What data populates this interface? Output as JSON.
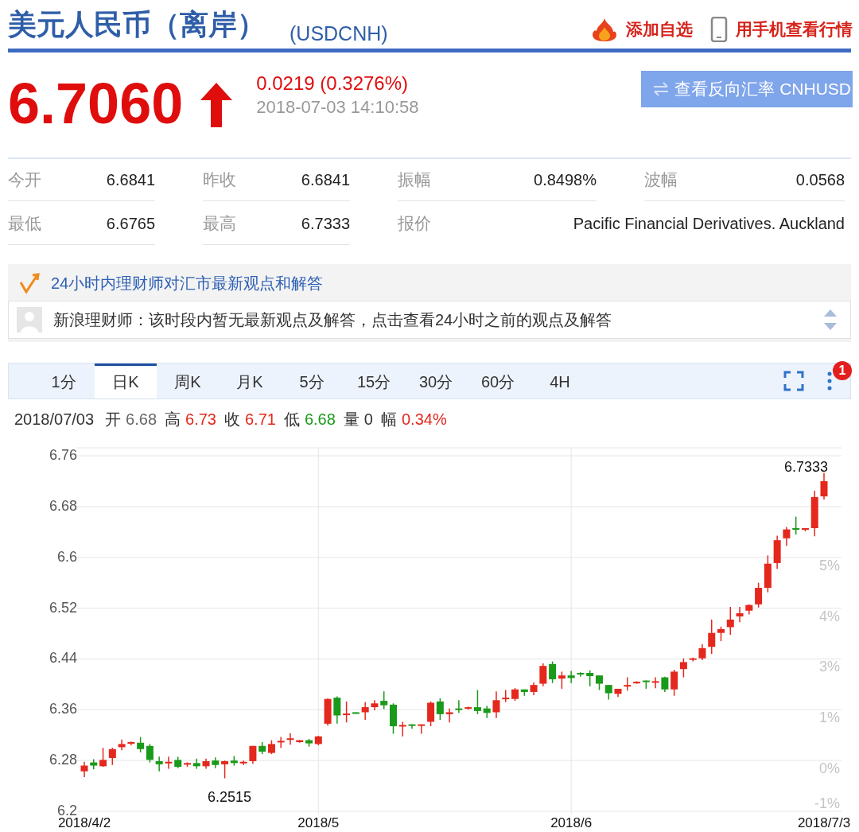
{
  "header": {
    "title": "美元人民币（离岸）",
    "symbol": "(USDCNH)",
    "actions": [
      {
        "kind": "favorite",
        "label": "添加自选"
      },
      {
        "kind": "mobile",
        "label": "用手机查看行情"
      }
    ]
  },
  "quote": {
    "price": "6.7060",
    "rising": true,
    "change": "0.0219 (0.3276%)",
    "time": "2018-07-03 14:10:58",
    "reverse_button": "查看反向汇率 CNHUSD"
  },
  "stats": [
    {
      "label": "今开",
      "value": "6.6841",
      "wide": false
    },
    {
      "label": "昨收",
      "value": "6.6841",
      "wide": false
    },
    {
      "label": "振幅",
      "value": "0.8498%",
      "wide": false
    },
    {
      "label": "波幅",
      "value": "0.0568",
      "wide": false
    },
    {
      "label": "最低",
      "value": "6.6765",
      "wide": false
    },
    {
      "label": "最高",
      "value": "6.7333",
      "wide": false
    },
    {
      "label": "报价",
      "value": "Pacific Financial Derivatives. Auckland",
      "wide": true
    }
  ],
  "advisor": {
    "heading": "24小时内理财师对汇市最新观点和解答",
    "message": "新浪理财师：该时段内暂无最新观点及解答，点击查看24小时之前的观点及解答"
  },
  "chart_tabs": [
    {
      "label": "1分",
      "selected": false
    },
    {
      "label": "日K",
      "selected": true
    },
    {
      "label": "周K",
      "selected": false
    },
    {
      "label": "月K",
      "selected": false
    },
    {
      "label": "5分",
      "selected": false
    },
    {
      "label": "15分",
      "selected": false
    },
    {
      "label": "30分",
      "selected": false
    },
    {
      "label": "60分",
      "selected": false
    },
    {
      "label": "4H",
      "selected": false
    }
  ],
  "menu_badge": "1",
  "ohlc_line": {
    "date": "2018/07/03",
    "items": [
      {
        "label": "开",
        "value": "6.68",
        "color": "#666666"
      },
      {
        "label": "高",
        "value": "6.73",
        "color": "#e4281d"
      },
      {
        "label": "收",
        "value": "6.71",
        "color": "#e4281d"
      },
      {
        "label": "低",
        "value": "6.68",
        "color": "#1a9a1a"
      },
      {
        "label": "量",
        "value": "0",
        "color": "#333333"
      },
      {
        "label": "幅",
        "value": "0.34%",
        "color": "#e4281d"
      }
    ]
  },
  "chart": {
    "right_axis_labels": [
      "5%",
      "4%",
      "3%",
      "1%",
      "0%",
      "-1%"
    ],
    "chart_data": {
      "type": "candlestick",
      "grid": true,
      "ylim": [
        6.2,
        6.76
      ],
      "yticks": [
        6.2,
        6.28,
        6.36,
        6.44,
        6.52,
        6.6,
        6.68,
        6.76
      ],
      "annotations": [
        {
          "text": "6.2515"
        },
        {
          "text": "6.7333"
        }
      ],
      "categories": [
        "2018/4/2",
        null,
        null,
        null,
        null,
        null,
        null,
        null,
        null,
        null,
        null,
        null,
        null,
        null,
        null,
        null,
        null,
        null,
        null,
        null,
        null,
        null,
        null,
        null,
        null,
        "2018/5",
        null,
        null,
        null,
        null,
        null,
        null,
        null,
        null,
        null,
        null,
        null,
        null,
        null,
        null,
        null,
        null,
        null,
        null,
        null,
        null,
        null,
        null,
        null,
        null,
        null,
        null,
        "2018/6",
        null,
        null,
        null,
        null,
        null,
        null,
        null,
        null,
        null,
        null,
        null,
        null,
        null,
        null,
        null,
        null,
        null,
        null,
        null,
        null,
        null,
        null,
        null,
        null,
        null,
        null,
        "2018/7/3"
      ],
      "ohlc": [
        [
          6.263,
          6.278,
          6.254,
          6.272
        ],
        [
          6.277,
          6.282,
          6.266,
          6.272
        ],
        [
          6.271,
          6.3,
          6.27,
          6.281
        ],
        [
          6.284,
          6.3,
          6.273,
          6.298
        ],
        [
          6.301,
          6.313,
          6.296,
          6.306
        ],
        [
          6.307,
          6.31,
          6.304,
          6.309
        ],
        [
          6.308,
          6.317,
          6.293,
          6.298
        ],
        [
          6.303,
          6.306,
          6.277,
          6.281
        ],
        [
          6.279,
          6.286,
          6.263,
          6.274
        ],
        [
          6.277,
          6.286,
          6.267,
          6.278
        ],
        [
          6.281,
          6.286,
          6.268,
          6.27
        ],
        [
          6.275,
          6.277,
          6.27,
          6.276
        ],
        [
          6.276,
          6.283,
          6.267,
          6.271
        ],
        [
          6.271,
          6.283,
          6.267,
          6.279
        ],
        [
          6.28,
          6.285,
          6.268,
          6.273
        ],
        [
          6.274,
          6.28,
          6.252,
          6.279
        ],
        [
          6.28,
          6.287,
          6.272,
          6.276
        ],
        [
          6.277,
          6.28,
          6.273,
          6.278
        ],
        [
          6.279,
          6.303,
          6.275,
          6.303
        ],
        [
          6.303,
          6.309,
          6.29,
          6.294
        ],
        [
          6.292,
          6.312,
          6.29,
          6.306
        ],
        [
          6.309,
          6.317,
          6.3,
          6.311
        ],
        [
          6.314,
          6.323,
          6.305,
          6.315
        ],
        [
          6.309,
          6.312,
          6.308,
          6.312
        ],
        [
          6.312,
          6.314,
          6.302,
          6.307
        ],
        [
          6.306,
          6.319,
          6.304,
          6.318
        ],
        [
          6.338,
          6.378,
          6.335,
          6.377
        ],
        [
          6.379,
          6.381,
          6.338,
          6.351
        ],
        [
          6.352,
          6.373,
          6.34,
          6.354
        ],
        [
          6.356,
          6.356,
          6.354,
          6.355
        ],
        [
          6.356,
          6.372,
          6.344,
          6.364
        ],
        [
          6.364,
          6.375,
          6.359,
          6.37
        ],
        [
          6.374,
          6.389,
          6.361,
          6.367
        ],
        [
          6.368,
          6.37,
          6.322,
          6.334
        ],
        [
          6.334,
          6.341,
          6.318,
          6.336
        ],
        [
          6.337,
          6.337,
          6.33,
          6.335
        ],
        [
          6.336,
          6.337,
          6.322,
          6.337
        ],
        [
          6.341,
          6.373,
          6.334,
          6.371
        ],
        [
          6.373,
          6.378,
          6.344,
          6.353
        ],
        [
          6.353,
          6.362,
          6.34,
          6.356
        ],
        [
          6.362,
          6.375,
          6.355,
          6.361
        ],
        [
          6.362,
          6.365,
          6.36,
          6.364
        ],
        [
          6.364,
          6.391,
          6.353,
          6.358
        ],
        [
          6.362,
          6.366,
          6.347,
          6.355
        ],
        [
          6.356,
          6.389,
          6.347,
          6.375
        ],
        [
          6.378,
          6.391,
          6.372,
          6.379
        ],
        [
          6.377,
          6.394,
          6.374,
          6.392
        ],
        [
          6.392,
          6.392,
          6.382,
          6.388
        ],
        [
          6.388,
          6.403,
          6.383,
          6.399
        ],
        [
          6.401,
          6.433,
          6.397,
          6.429
        ],
        [
          6.432,
          6.436,
          6.402,
          6.408
        ],
        [
          6.409,
          6.42,
          6.393,
          6.414
        ],
        [
          6.414,
          6.421,
          6.402,
          6.41
        ],
        [
          6.418,
          6.419,
          6.412,
          6.416
        ],
        [
          6.418,
          6.422,
          6.397,
          6.413
        ],
        [
          6.414,
          6.414,
          6.391,
          6.401
        ],
        [
          6.399,
          6.399,
          6.376,
          6.386
        ],
        [
          6.385,
          6.393,
          6.38,
          6.393
        ],
        [
          6.398,
          6.411,
          6.39,
          6.399
        ],
        [
          6.403,
          6.405,
          6.401,
          6.404
        ],
        [
          6.406,
          6.406,
          6.393,
          6.405
        ],
        [
          6.404,
          6.411,
          6.394,
          6.405
        ],
        [
          6.411,
          6.412,
          6.388,
          6.392
        ],
        [
          6.392,
          6.423,
          6.382,
          6.42
        ],
        [
          6.424,
          6.441,
          6.411,
          6.435
        ],
        [
          6.44,
          6.442,
          6.436,
          6.441
        ],
        [
          6.441,
          6.463,
          6.438,
          6.457
        ],
        [
          6.459,
          6.502,
          6.448,
          6.481
        ],
        [
          6.481,
          6.491,
          6.468,
          6.487
        ],
        [
          6.49,
          6.522,
          6.478,
          6.502
        ],
        [
          6.507,
          6.522,
          6.498,
          6.512
        ],
        [
          6.516,
          6.526,
          6.51,
          6.525
        ],
        [
          6.526,
          6.56,
          6.521,
          6.552
        ],
        [
          6.552,
          6.603,
          6.545,
          6.59
        ],
        [
          6.591,
          6.634,
          6.582,
          6.627
        ],
        [
          6.63,
          6.648,
          6.618,
          6.644
        ],
        [
          6.646,
          6.664,
          6.636,
          6.644
        ],
        [
          6.644,
          6.646,
          6.641,
          6.646
        ],
        [
          6.646,
          6.705,
          6.633,
          6.695
        ],
        [
          6.696,
          6.733,
          6.691,
          6.72
        ]
      ]
    }
  }
}
